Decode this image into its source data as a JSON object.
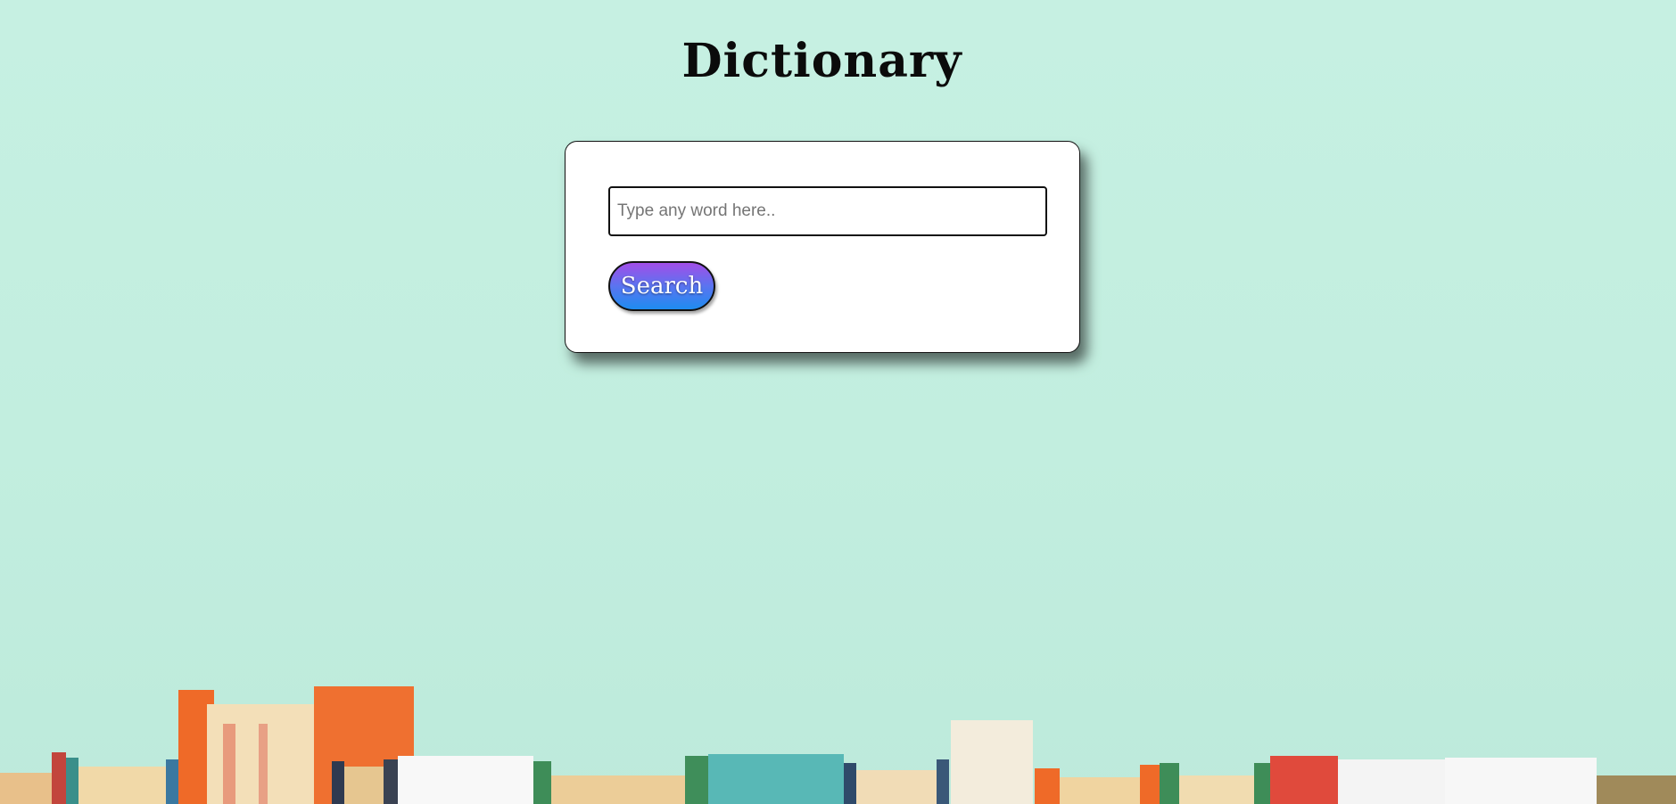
{
  "page": {
    "title": "Dictionary"
  },
  "search": {
    "placeholder": "Type any word here..",
    "value": "",
    "button_label": "Search"
  },
  "colors": {
    "background": "#c6f0e2",
    "button_gradient_top": "#a24ee8",
    "button_gradient_bottom": "#1e8cf0",
    "card": "#ffffff"
  },
  "decor": {
    "footer_image": "bookshelf-photo"
  }
}
